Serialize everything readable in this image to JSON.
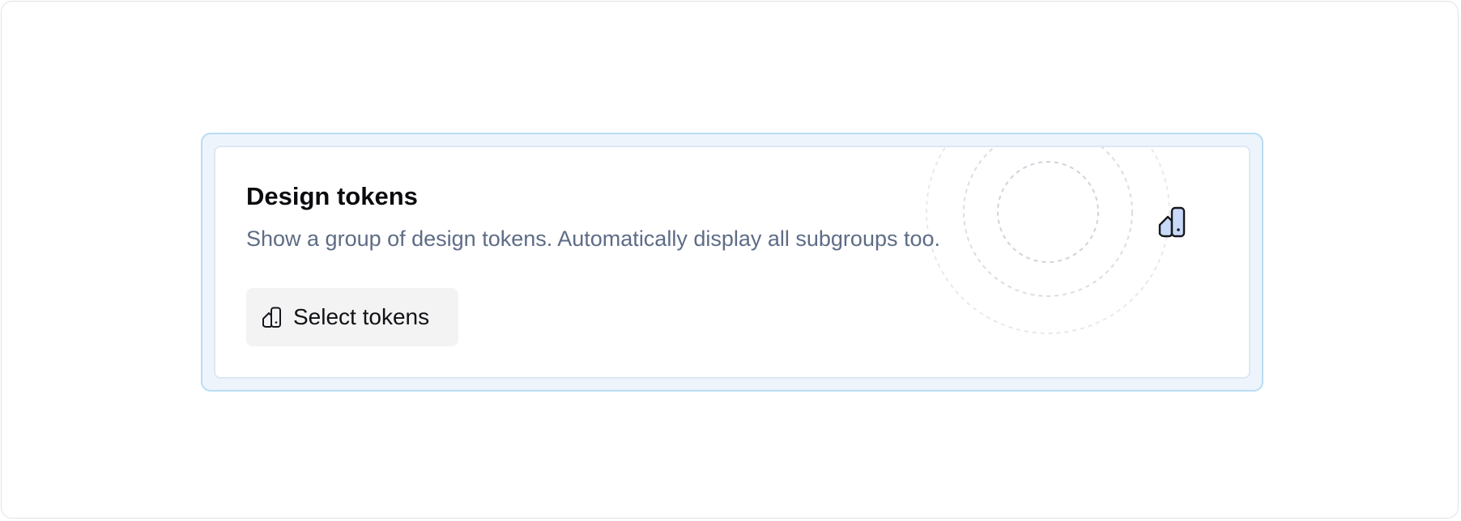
{
  "block": {
    "title": "Design tokens",
    "description": "Show a group of design tokens. Automatically display all subgroups too.",
    "select_button_label": "Select tokens",
    "button_icon": "design-tokens-icon",
    "illustration_icon": "design-tokens-icon"
  },
  "colors": {
    "accent_border": "#b9dcf3",
    "accent_bg": "#eef4fc",
    "icon_fill": "#c9daf8",
    "description_text": "#5e6c86"
  }
}
